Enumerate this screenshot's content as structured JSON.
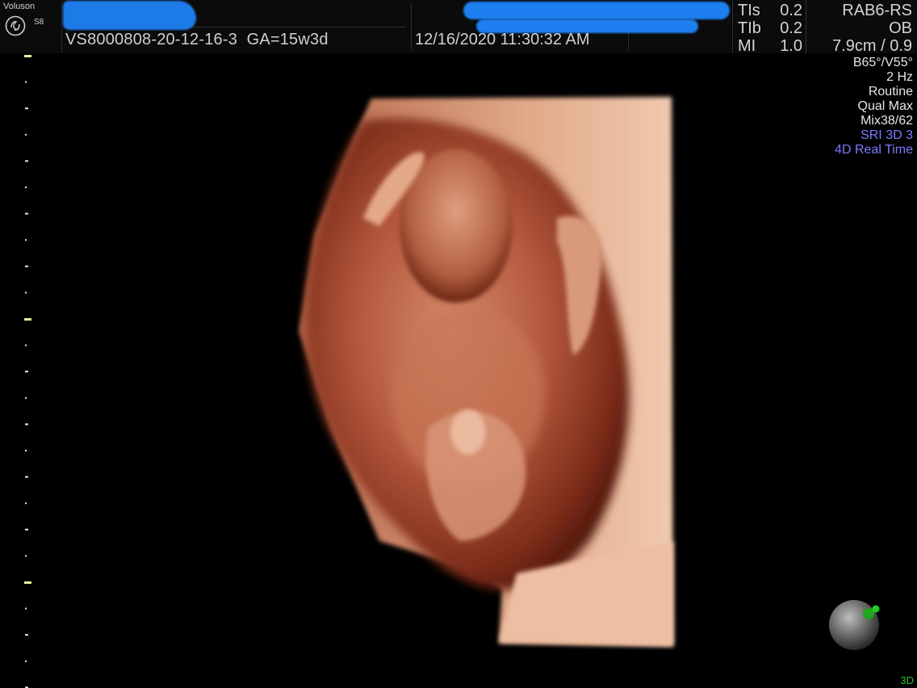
{
  "header": {
    "brand": "Voluson",
    "model": "S8",
    "exam_id": "VS8000808-20-12-16-3",
    "gestational_age": "GA=15w3d",
    "datetime": "12/16/2020 11:30:32 AM"
  },
  "safety": [
    {
      "label": "TIs",
      "value": "0.2"
    },
    {
      "label": "TIb",
      "value": "0.2"
    },
    {
      "label": "MI",
      "value": "1.0"
    }
  ],
  "probe": {
    "name": "RAB6-RS",
    "preset": "OB",
    "depth": "7.9cm / 0.9"
  },
  "params": {
    "angles": "B65°/V55°",
    "rate": "2 Hz",
    "mode": "Routine",
    "quality": "Qual Max",
    "mix": "Mix38/62",
    "sri": "SRI 3D 3",
    "realtime": "4D Real Time"
  },
  "status": {
    "mode_label": "3D"
  },
  "colors": {
    "background": "#000000",
    "redaction": "#1e7ff0",
    "highlight": "#7b7bff",
    "accent_green": "#2fbf2f",
    "scale_marker": "#f0ee9a"
  },
  "icons": {
    "logo": "ge-logo-icon",
    "orientation": "orientation-ball-icon"
  }
}
